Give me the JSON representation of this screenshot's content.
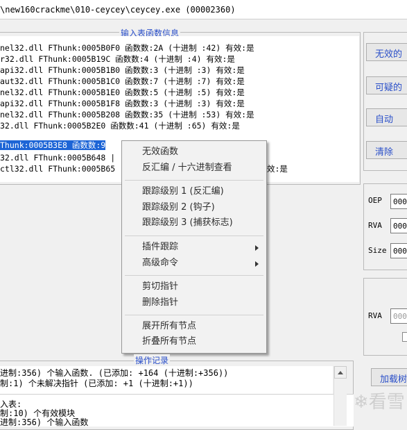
{
  "window": {
    "title": "\\new160crackme\\010-ceycey\\ceycey.exe (00002360)"
  },
  "import_group": {
    "legend": "输入表函数信息",
    "rows": [
      "nel32.dll FThunk:0005B0F0 函数数:2A (十进制 :42) 有效:是",
      "r32.dll FThunk:0005B19C 函数数:4 (十进制 :4) 有效:是",
      "api32.dll FThunk:0005B1B0 函数数:3 (十进制 :3) 有效:是",
      "aut32.dll FThunk:0005B1C0 函数数:7 (十进制 :7) 有效:是",
      "nel32.dll FThunk:0005B1E0 函数数:5 (十进制 :5) 有效:是",
      "api32.dll FThunk:0005B1F8 函数数:3 (十进制 :3) 有效:是",
      "nel32.dll FThunk:0005B208 函数数:35 (十进制 :53) 有效:是",
      "32.dll FThunk:0005B2E0 函数数:41 (十进制 :65) 有效:是",
      "Thunk:0005B3E8 函数数:9",
      "32.dll FThunk:0005B648 |",
      "ctl32.dll FThunk:0005B65"
    ],
    "row_tail": "效:是"
  },
  "right_buttons": [
    "无效的",
    "可疑的",
    "自动",
    "清除"
  ],
  "fields": {
    "oep_label": "OEP",
    "oep_value": "000",
    "rva_label": "RVA",
    "rva_value": "000",
    "size_label": "Size",
    "size_value": "000",
    "rva2_label": "RVA",
    "rva2_value": "000"
  },
  "context_menu": {
    "items": [
      "无效函数",
      "反汇编 / 十六进制查看",
      "跟踪级别 1 (反汇编)",
      "跟踪级别 2 (钩子)",
      "跟踪级别 3 (捕获标志)",
      "插件跟踪",
      "高级命令",
      "剪切指针",
      "删除指针",
      "展开所有节点",
      "折叠所有节点"
    ]
  },
  "log_group": {
    "legend": "操作记录",
    "lines": [
      "进制:356) 个输入函数. (已添加: +164 (十进制:+356))",
      "制:1) 个未解决指针 (已添加: +1 (十进制:+1))",
      "入表:",
      "制:10) 个有效模块",
      "进制:356) 个输入函数"
    ]
  },
  "load_button": "加载树",
  "watermark": "看雪"
}
